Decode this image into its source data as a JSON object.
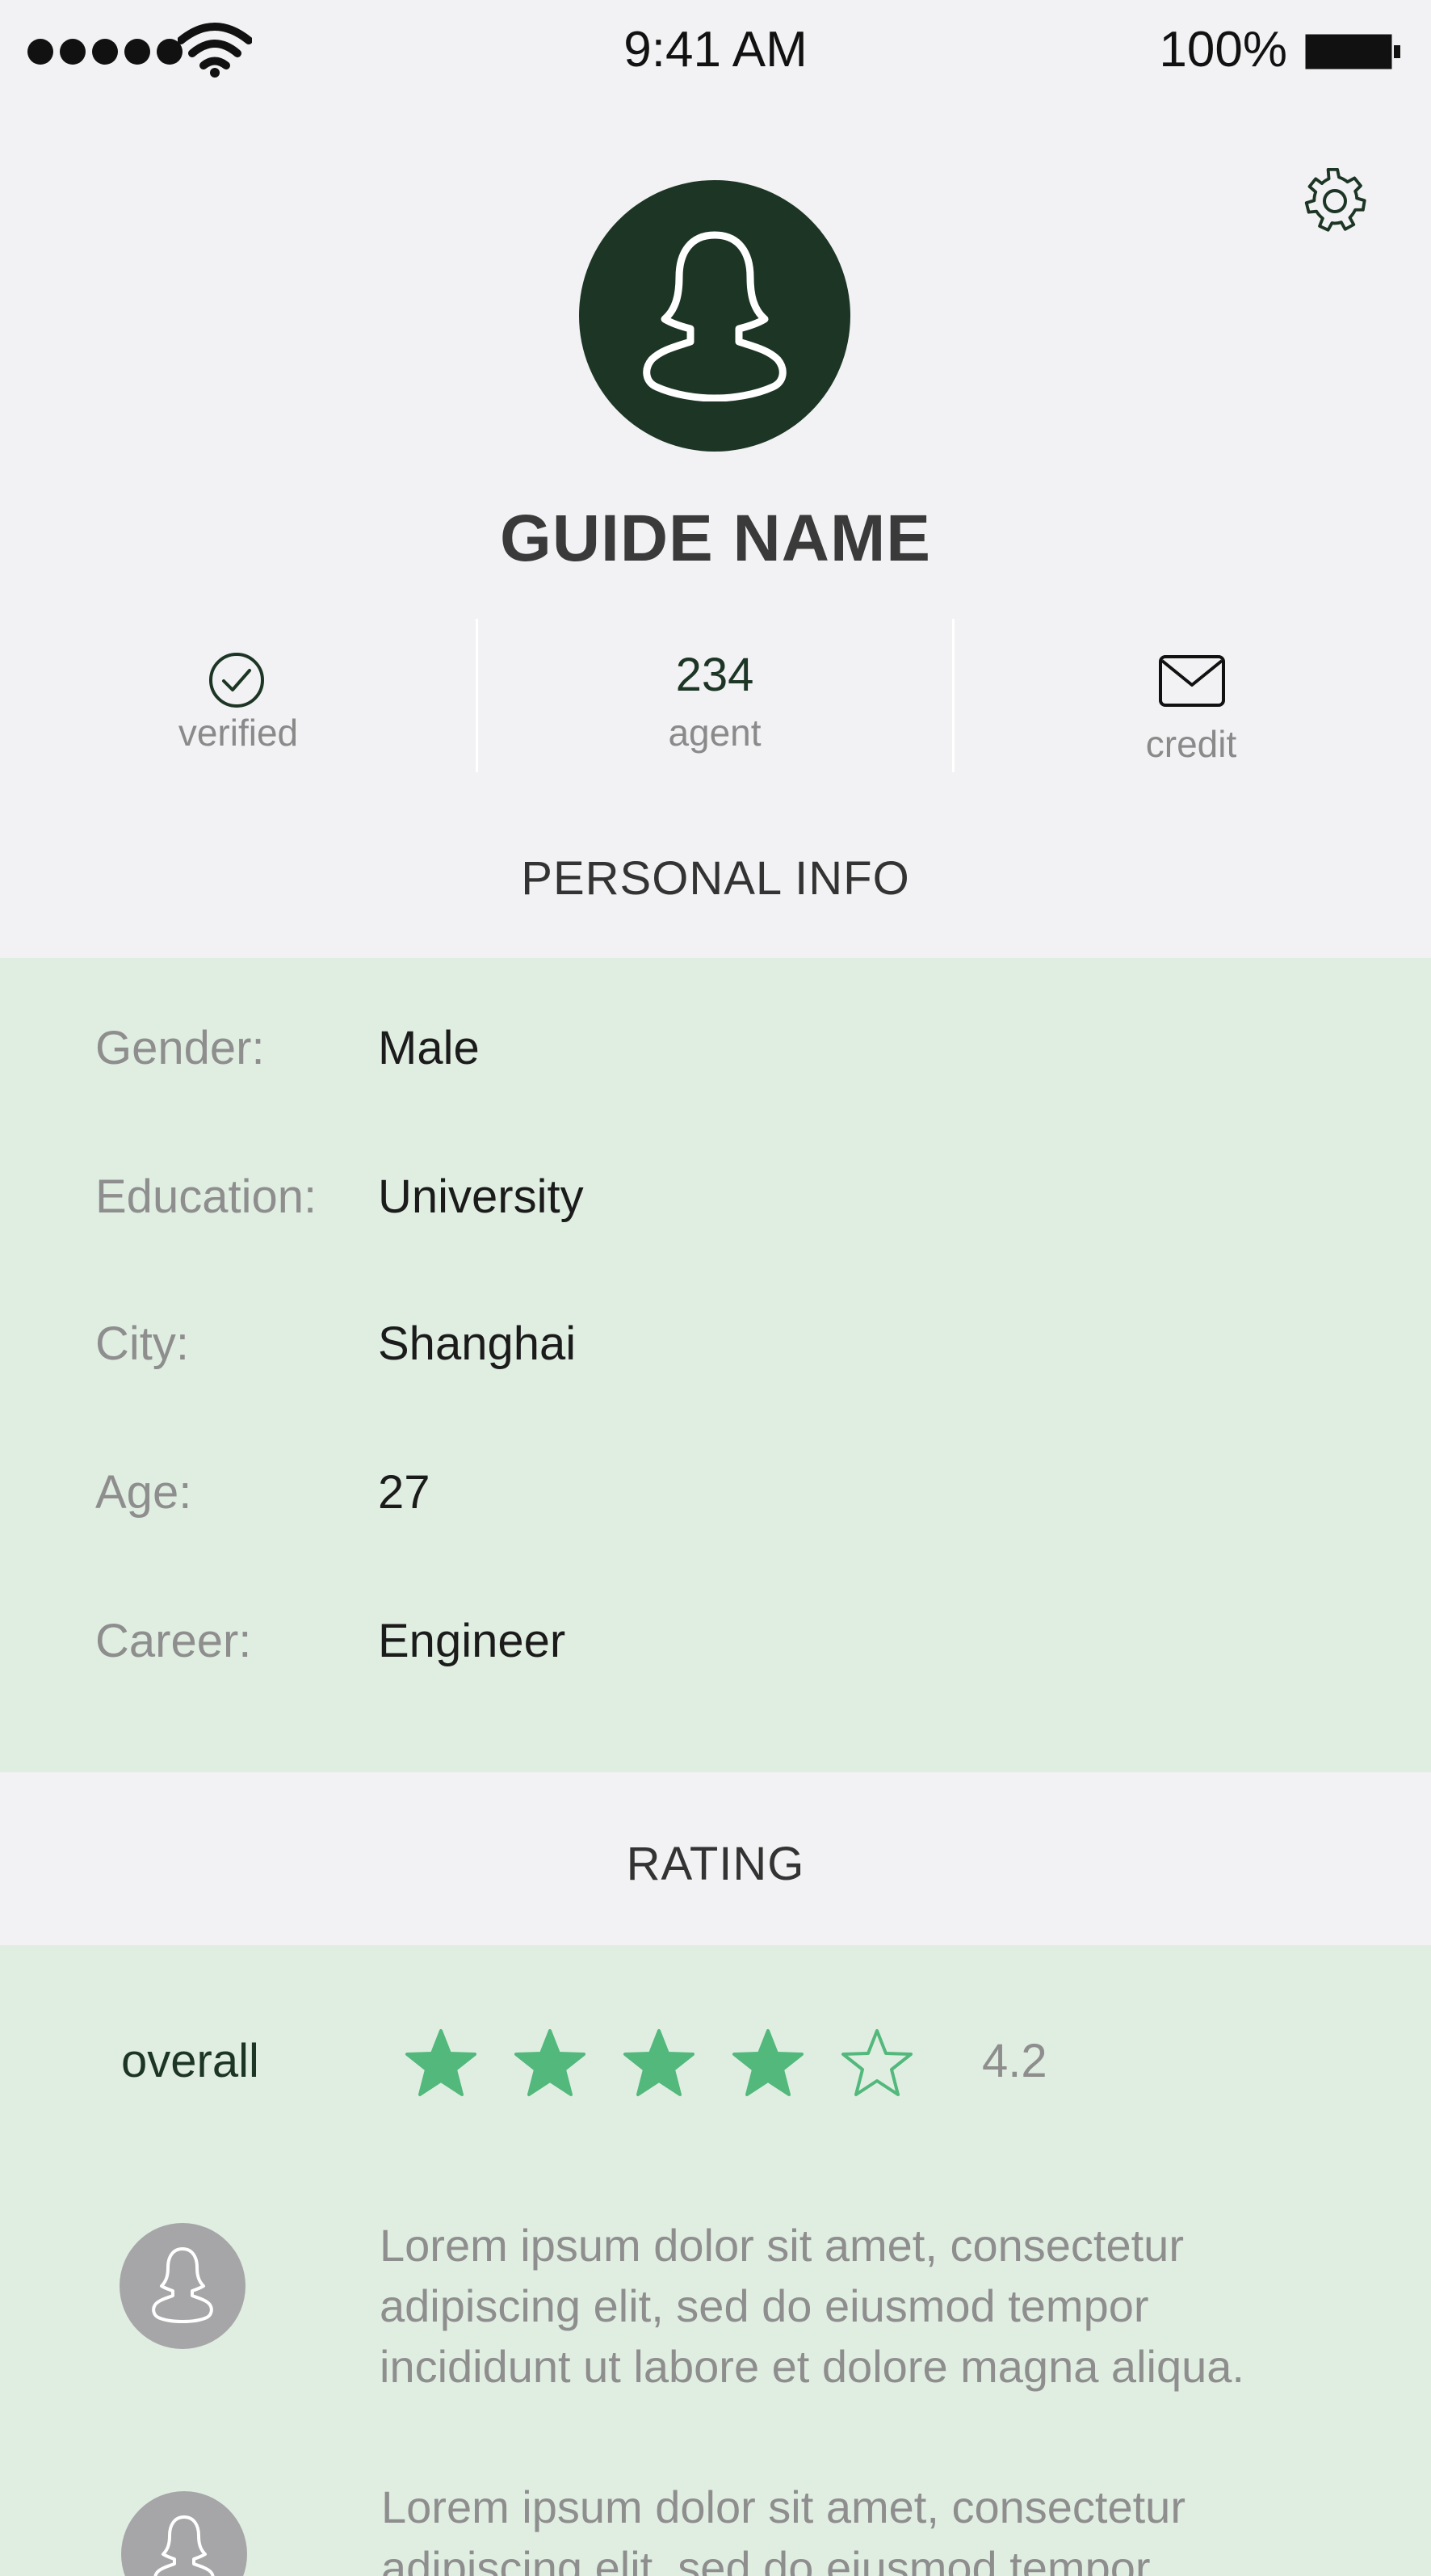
{
  "status_bar": {
    "time": "9:41 AM",
    "battery": "100%"
  },
  "profile": {
    "name": "GUIDE NAME",
    "stats": {
      "verified_label": "verified",
      "agent_count": "234",
      "agent_label": "agent",
      "credit_label": "credit"
    }
  },
  "personal_info": {
    "title": "PERSONAL INFO",
    "rows": [
      {
        "label": "Gender:",
        "value": "Male"
      },
      {
        "label": "Education:",
        "value": "University"
      },
      {
        "label": "City:",
        "value": "Shanghai"
      },
      {
        "label": "Age:",
        "value": "27"
      },
      {
        "label": "Career:",
        "value": "Engineer"
      }
    ]
  },
  "rating": {
    "title": "RATING",
    "overall_label": "overall",
    "value": "4.2",
    "stars_filled": 4,
    "stars_total": 5,
    "star_color": "#52b87b",
    "reviews": [
      {
        "text": "Lorem ipsum dolor sit amet, consectetur adipiscing elit, sed do eiusmod tempor incididunt ut labore et dolore magna aliqua."
      },
      {
        "text": "Lorem ipsum dolor sit amet, consectetur adipiscing elit, sed do eiusmod tempor"
      }
    ]
  },
  "colors": {
    "background": "#f2f2f4",
    "panel": "#e0eee2",
    "avatar": "#1c3524",
    "review_avatar": "#a6a6a8"
  }
}
